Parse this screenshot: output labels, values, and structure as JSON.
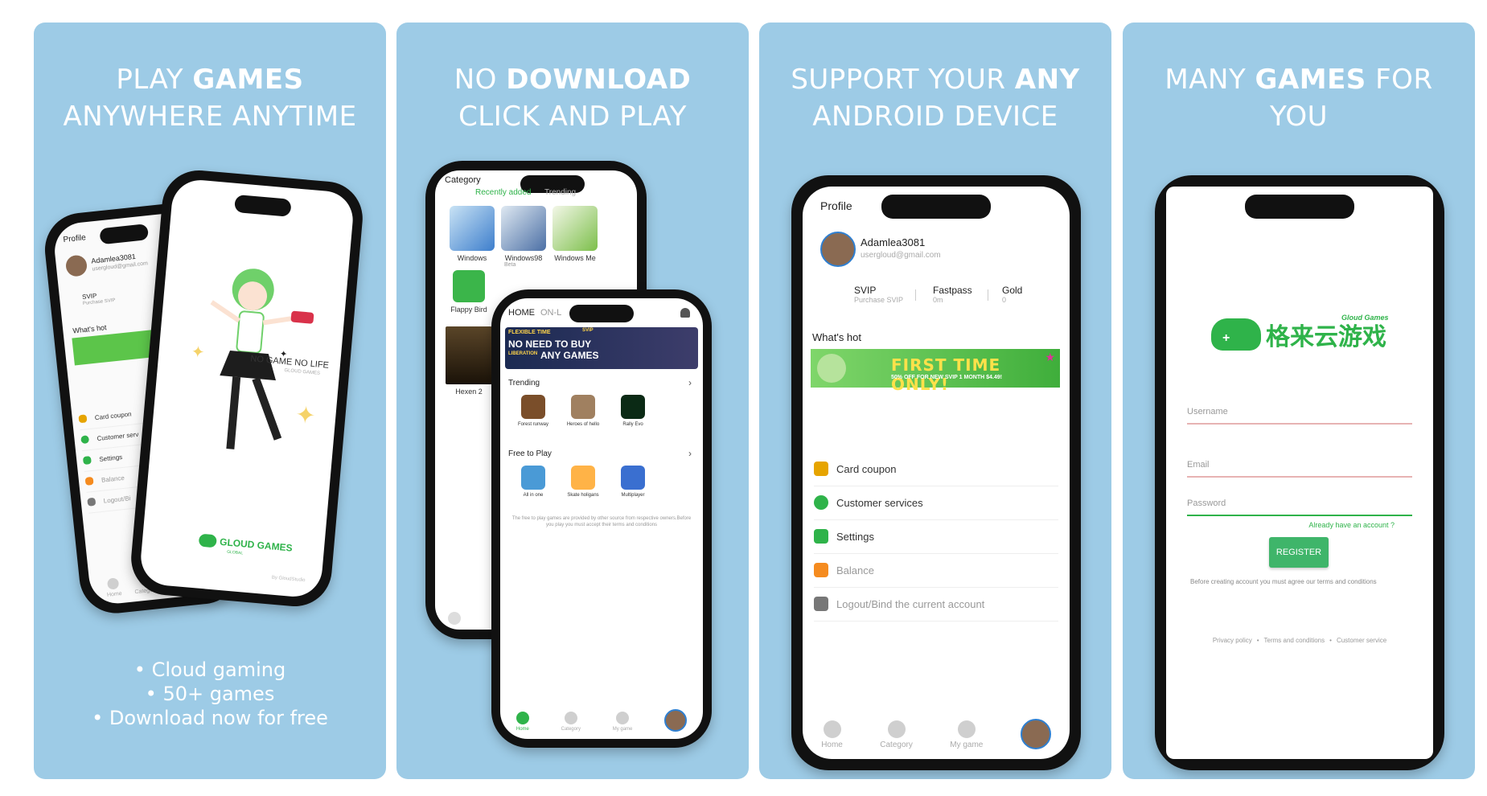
{
  "colors": {
    "card_bg": "#9dcbe6",
    "accent_green": "#2fb34a",
    "banner_green": "#5cc54a",
    "white": "#ffffff"
  },
  "panels": [
    {
      "headline": {
        "pre": "PLAY ",
        "bold": "GAMES",
        "post": "",
        "line2": "ANYWHERE ANYTIME"
      },
      "bullets": [
        "• Cloud gaming",
        "• 50+ games",
        "• Download now for free"
      ]
    },
    {
      "headline": {
        "pre": "NO ",
        "bold": "DOWNLOAD",
        "post": "",
        "line2": "CLICK AND PLAY"
      }
    },
    {
      "headline": {
        "pre": "SUPPORT YOUR ",
        "bold": "ANY",
        "post": "",
        "line2": "ANDROID DEVICE"
      }
    },
    {
      "headline": {
        "pre": "MANY ",
        "bold": "GAMES",
        "post": " FOR",
        "line2": "YOU"
      }
    }
  ],
  "profile": {
    "title": "Profile",
    "username": "Adamlea3081",
    "email": "usergloud@gmail.com",
    "stats": [
      {
        "label": "SVIP",
        "sub": "Purchase SVIP"
      },
      {
        "label": "Fastpass",
        "sub": "0m"
      },
      {
        "label": "Gold",
        "sub": "0"
      }
    ],
    "whats_hot": "What's hot",
    "banner_title": "FIRST TIME ONLY!",
    "banner_sub": "50% OFF FOR NEW  SVIP 1 MONTH $4.49!",
    "menu": [
      "Card coupon",
      "Customer services",
      "Settings",
      "Balance",
      "Logout/Bind the current account"
    ],
    "nav": [
      "Home",
      "Category",
      "My game"
    ]
  },
  "splash": {
    "tagline": "NO GAME NO LIFE",
    "tagline_sub": "GLOUD GAMES",
    "brand": "GLOUD GAMES",
    "brand_sub": "GLOBAL",
    "credit": "By GloudStudio"
  },
  "small_profile": {
    "title": "Profile",
    "username": "Adamlea3081",
    "email": "usergloud@gmail.com",
    "svip": "SVIP",
    "svip_sub": "Purchase SVIP",
    "whats_hot": "What's hot",
    "menu": [
      "Card coupon",
      "Customer serv",
      "Settings",
      "Balance",
      "Logout/Bi"
    ],
    "nav": [
      "Home",
      "Category"
    ]
  },
  "category": {
    "title": "Category",
    "tabs": [
      "Recently added",
      "Trending"
    ],
    "games": [
      {
        "name": "Windows"
      },
      {
        "name": "Windows98"
      },
      {
        "name": "Windows Me"
      },
      {
        "name": "Flappy Bird"
      },
      {
        "name": "Hexen 2"
      }
    ],
    "beta": "Beta"
  },
  "home": {
    "tabs": [
      "HOME",
      "ON-L"
    ],
    "banner_lines": [
      "FLEXIBLE TIME",
      "SVIP",
      "NO NEED TO BUY",
      "LIBERATION",
      "ANY GAMES"
    ],
    "trending": "Trending",
    "trending_games": [
      "Forest runway",
      "Heroes of hello",
      "Rally Evo"
    ],
    "free": "Free to Play",
    "free_games": [
      "All in one",
      "Skate holigans",
      "Multiplayer"
    ],
    "disclaimer": "The free to play games are provided by other source from respective owners.Before you play you must accept their terms and conditions",
    "nav": [
      "Home",
      "Category",
      "My game"
    ]
  },
  "register": {
    "brand_cn": "格来云游戏",
    "brand_en": "Gloud Games",
    "username": "Username",
    "email": "Email",
    "password": "Password",
    "have_account": "Already have an account ?",
    "button": "REGISTER",
    "terms_note": "Before creating account you must agree our terms and conditions",
    "footer": [
      "Privacy policy",
      "Terms and conditions",
      "Customer service"
    ]
  }
}
